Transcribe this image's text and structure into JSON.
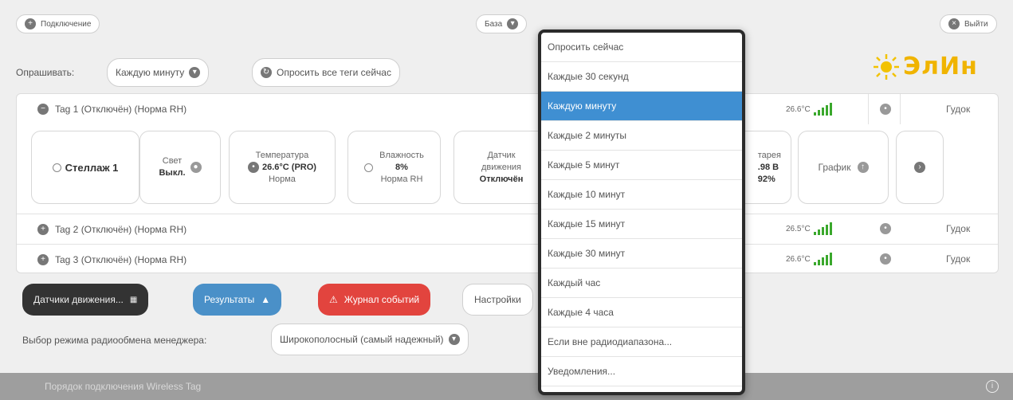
{
  "topbar": {
    "connect_label": "Подключение",
    "base_label": "База",
    "exit_label": "Выйти"
  },
  "poll": {
    "label": "Опрашивать:",
    "interval_value": "Каждую минуту",
    "poll_all_label": "Опросить все теги сейчас"
  },
  "logo_text": "ЭлИн",
  "tags": [
    {
      "title": "Tag 1 (Отключён) (Норма RH)",
      "temp": "26.6°C",
      "beep": "Гудок"
    },
    {
      "title": "Tag 2 (Отключён) (Норма RH)",
      "temp": "26.5°C",
      "beep": "Гудок"
    },
    {
      "title": "Tag 3 (Отключён) (Норма RH)",
      "temp": "26.6°C",
      "beep": "Гудок"
    }
  ],
  "cards": {
    "rack": "Стеллаж 1",
    "light_label": "Свет",
    "light_value": "Выкл.",
    "temp_label": "Температура",
    "temp_value": "26.6°C (PRO)",
    "temp_status": "Норма",
    "hum_label": "Влажность",
    "hum_value": "8%",
    "hum_status": "Норма RH",
    "motion_label1": "Датчик",
    "motion_label2": "движения",
    "motion_value": "Отключён",
    "battery_label": "тарея",
    "battery_value": ".98 В",
    "battery_pct": "92%",
    "graph_label": "График"
  },
  "buttons": {
    "motion_sensors": "Датчики движения...",
    "results": "Результаты",
    "event_log": "Журнал событий",
    "settings": "Настройки"
  },
  "radio": {
    "label": "Выбор режима радиообмена менеджера:",
    "value": "Широкополосный (самый надежный)"
  },
  "footer": {
    "text": "Порядок подключения Wireless Tag"
  },
  "dropdown": {
    "items": [
      "Опросить сейчас",
      "Каждые 30 секунд",
      "Каждую минуту",
      "Каждые 2 минуты",
      "Каждые 5 минут",
      "Каждые 10 минут",
      "Каждые 15 минут",
      "Каждые 30 минут",
      "Каждый час",
      "Каждые 4 часа",
      "Если вне радиодиапазона...",
      "Уведомления..."
    ],
    "selected_index": 2
  },
  "colors": {
    "selected": "#3f8fd2",
    "results_button": "#4a90c8",
    "event_log_button": "#e2443e",
    "motion_button": "#333333",
    "signal": "#3aa82c"
  },
  "icons": {
    "add": "plus-circle-icon",
    "exit": "close-circle-icon",
    "chevron": "chevron-down-icon",
    "bars": "signal-bars-icon"
  }
}
